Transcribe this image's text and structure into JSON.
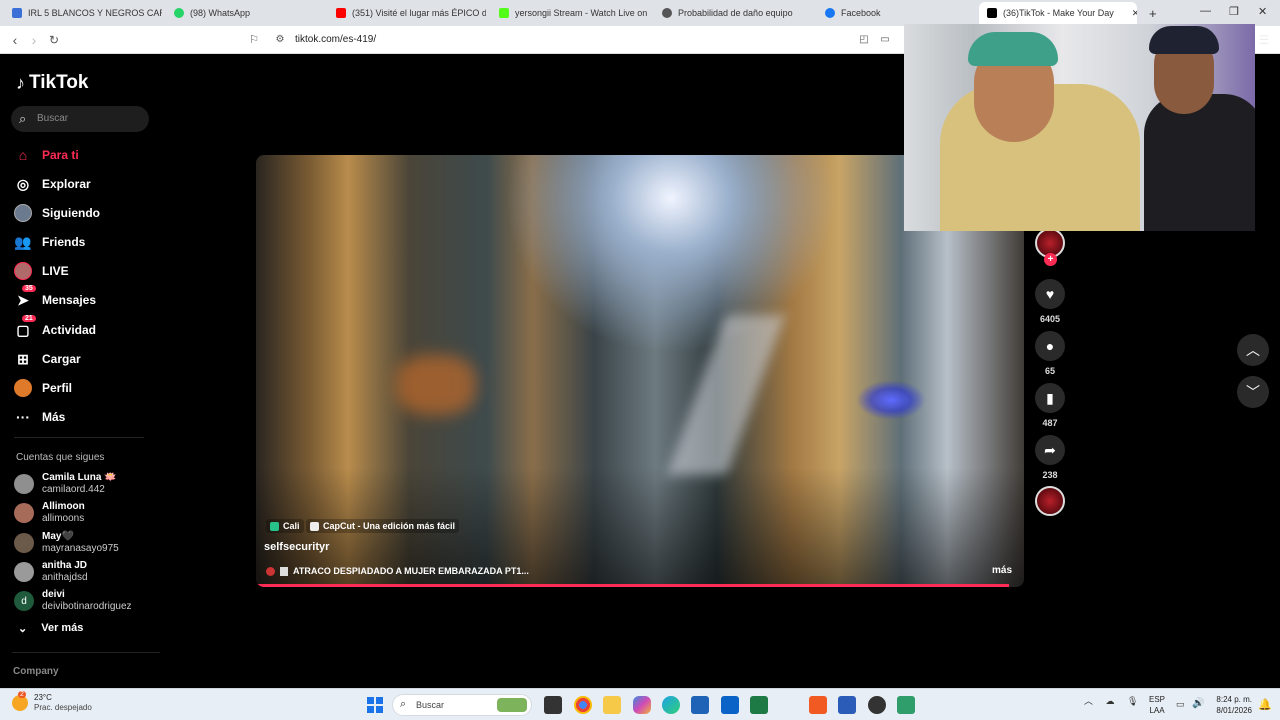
{
  "browser": {
    "tabs": [
      {
        "label": "IRL 5 BLANCOS Y NEGROS CARNAB",
        "favicon_color": "#3b6fd8"
      },
      {
        "label": "(98) WhatsApp",
        "favicon_color": "#25d366"
      },
      {
        "label": "(351) Visité el lugar más ÉPICO de lo",
        "favicon_color": "#ff0000"
      },
      {
        "label": "yersongii Stream - Watch Live on Ki",
        "favicon_color": "#53fc18"
      },
      {
        "label": "Probabilidad de daño equipo",
        "favicon_color": "#444444"
      },
      {
        "label": "Facebook",
        "favicon_color": "#1877f2"
      },
      {
        "label": "(36)TikTok - Make Your Day",
        "favicon_color": "#000000"
      }
    ],
    "close_tab_glyph": "✕",
    "new_tab_glyph": "+",
    "url": "tiktok.com/es-419/"
  },
  "sidebar": {
    "logo_text": "TikTok",
    "search_placeholder": "Buscar",
    "nav": [
      {
        "label": "Para ti",
        "icon": "home-icon",
        "active": true
      },
      {
        "label": "Explorar",
        "icon": "compass-icon"
      },
      {
        "label": "Siguiendo",
        "icon": "following-avatar-icon"
      },
      {
        "label": "Friends",
        "icon": "friends-icon"
      },
      {
        "label": "LIVE",
        "icon": "live-icon"
      },
      {
        "label": "Mensajes",
        "icon": "messages-icon",
        "badge": "35"
      },
      {
        "label": "Actividad",
        "icon": "activity-icon",
        "badge": "21"
      },
      {
        "label": "Cargar",
        "icon": "upload-icon"
      },
      {
        "label": "Perfil",
        "icon": "profile-icon"
      },
      {
        "label": "Más",
        "icon": "more-dots-icon"
      }
    ],
    "following_heading": "Cuentas que sigues",
    "accounts": [
      {
        "name": "Camila Luna 🪷",
        "username": "camilaord.442",
        "avatar_color": "#8f8f8f"
      },
      {
        "name": "Allimoon",
        "username": "allimoons",
        "avatar_color": "#a76b5a"
      },
      {
        "name": "May🖤",
        "username": "mayranasayo975",
        "avatar_color": "#6b5a4a"
      },
      {
        "name": "anitha JD",
        "username": "anithajdsd",
        "avatar_color": "#9a9a9a"
      },
      {
        "name": "deivi",
        "username": "deivibotinarodriguez",
        "avatar_color": "#1f5a3c",
        "initial": "d"
      }
    ],
    "see_more": "Ver más",
    "company": "Company"
  },
  "video": {
    "tags": [
      "Cali",
      "CapCut - Una edición más fácil"
    ],
    "author": "selfsecurityr",
    "caption": "ATRACO DESPIADADO A MUJER EMBARAZADA PT1...",
    "more": "más",
    "progress": 0.98
  },
  "actions": {
    "likes": "6405",
    "comments": "65",
    "saves": "487",
    "shares": "238"
  },
  "taskbar": {
    "weather_temp": "23°C",
    "weather_desc": "Prac. despejado",
    "weather_badge": "2",
    "search_placeholder": "Buscar",
    "lang_top": "ESP",
    "lang_bottom": "LAA",
    "time": "8:24 p. m.",
    "date": "8/01/2026"
  }
}
